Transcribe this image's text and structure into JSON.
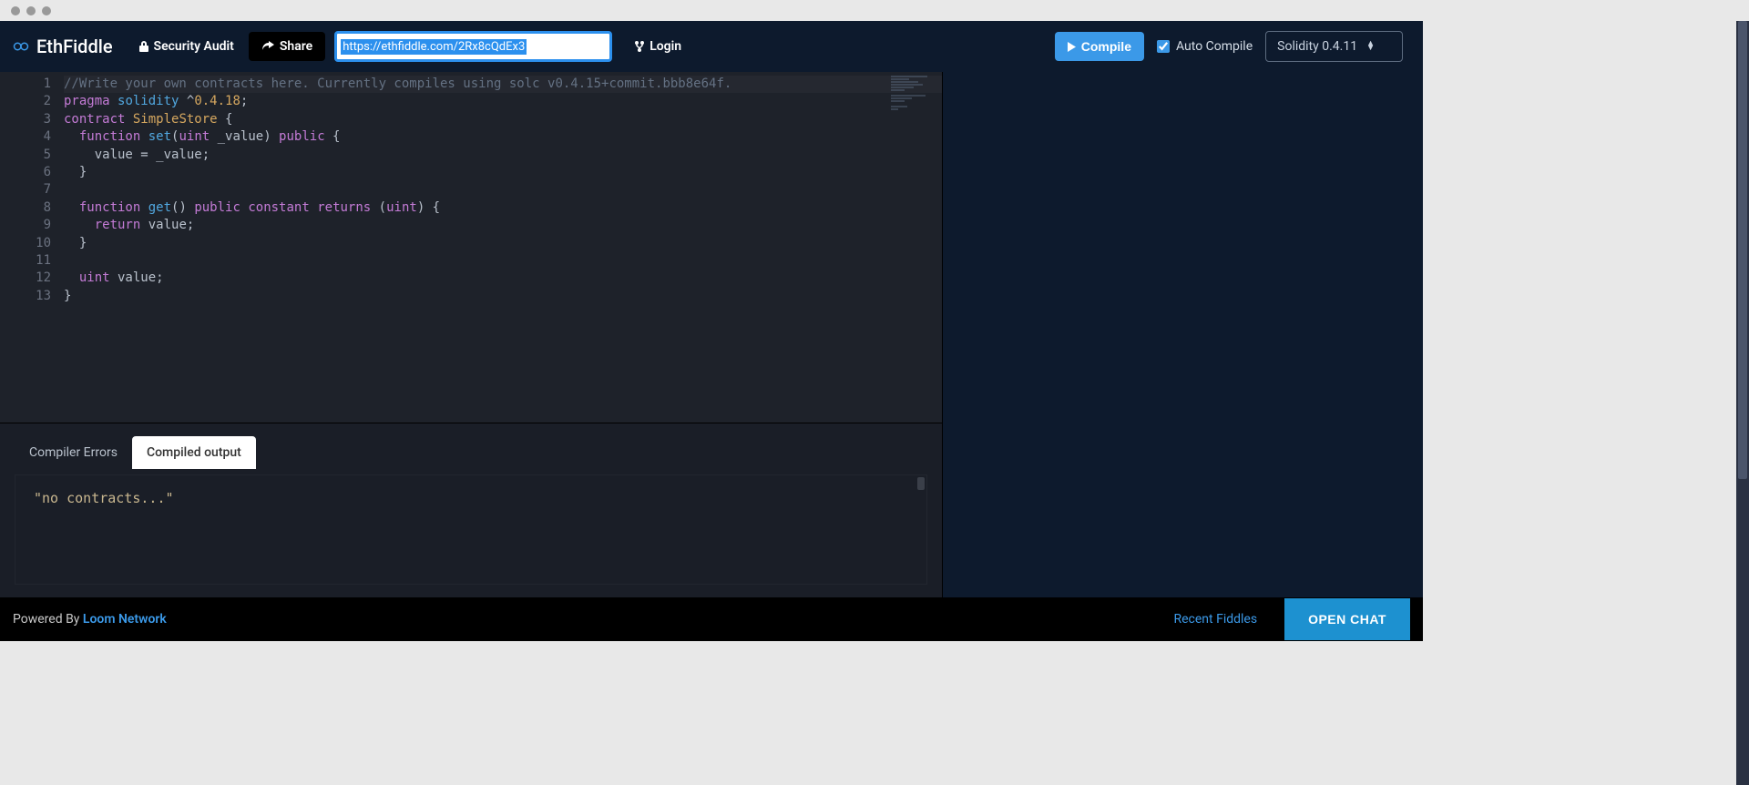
{
  "app_name": "EthFiddle",
  "nav": {
    "security_audit": "Security Audit",
    "share": "Share",
    "login": "Login"
  },
  "share_url": "https://ethfiddle.com/2Rx8cQdEx3",
  "compile": {
    "button": "Compile",
    "auto_label": "Auto Compile",
    "auto_checked": true,
    "version": "Solidity 0.4.11"
  },
  "editor": {
    "lines": [
      {
        "n": 1,
        "tokens": [
          {
            "t": "//Write your own contracts here. Currently compiles using solc v0.4.15+commit.bbb8e64f.",
            "c": "c-comment"
          }
        ]
      },
      {
        "n": 2,
        "tokens": [
          {
            "t": "pragma",
            "c": "c-keyword"
          },
          {
            "t": " ",
            "c": ""
          },
          {
            "t": "solidity",
            "c": "c-builtin"
          },
          {
            "t": " ^",
            "c": "c-punc"
          },
          {
            "t": "0.4.18",
            "c": "c-num"
          },
          {
            "t": ";",
            "c": "c-punc"
          }
        ]
      },
      {
        "n": 3,
        "tokens": [
          {
            "t": "contract",
            "c": "c-keyword"
          },
          {
            "t": " ",
            "c": ""
          },
          {
            "t": "SimpleStore",
            "c": "c-ident"
          },
          {
            "t": " {",
            "c": "c-punc"
          }
        ]
      },
      {
        "n": 4,
        "tokens": [
          {
            "t": "  ",
            "c": ""
          },
          {
            "t": "function",
            "c": "c-keyword"
          },
          {
            "t": " ",
            "c": ""
          },
          {
            "t": "set",
            "c": "c-fn"
          },
          {
            "t": "(",
            "c": "c-punc"
          },
          {
            "t": "uint",
            "c": "c-type"
          },
          {
            "t": " _value) ",
            "c": "c-punc"
          },
          {
            "t": "public",
            "c": "c-keyword"
          },
          {
            "t": " {",
            "c": "c-punc"
          }
        ]
      },
      {
        "n": 5,
        "tokens": [
          {
            "t": "    value = _value;",
            "c": "c-punc"
          }
        ]
      },
      {
        "n": 6,
        "tokens": [
          {
            "t": "  }",
            "c": "c-punc"
          }
        ]
      },
      {
        "n": 7,
        "tokens": [
          {
            "t": "",
            "c": ""
          }
        ]
      },
      {
        "n": 8,
        "tokens": [
          {
            "t": "  ",
            "c": ""
          },
          {
            "t": "function",
            "c": "c-keyword"
          },
          {
            "t": " ",
            "c": ""
          },
          {
            "t": "get",
            "c": "c-fn"
          },
          {
            "t": "() ",
            "c": "c-punc"
          },
          {
            "t": "public",
            "c": "c-keyword"
          },
          {
            "t": " ",
            "c": ""
          },
          {
            "t": "constant",
            "c": "c-keyword"
          },
          {
            "t": " ",
            "c": ""
          },
          {
            "t": "returns",
            "c": "c-keyword"
          },
          {
            "t": " (",
            "c": "c-punc"
          },
          {
            "t": "uint",
            "c": "c-type"
          },
          {
            "t": ") {",
            "c": "c-punc"
          }
        ]
      },
      {
        "n": 9,
        "tokens": [
          {
            "t": "    ",
            "c": ""
          },
          {
            "t": "return",
            "c": "c-keyword"
          },
          {
            "t": " value;",
            "c": "c-punc"
          }
        ]
      },
      {
        "n": 10,
        "tokens": [
          {
            "t": "  }",
            "c": "c-punc"
          }
        ]
      },
      {
        "n": 11,
        "tokens": [
          {
            "t": "",
            "c": ""
          }
        ]
      },
      {
        "n": 12,
        "tokens": [
          {
            "t": "  ",
            "c": ""
          },
          {
            "t": "uint",
            "c": "c-type"
          },
          {
            "t": " value;",
            "c": "c-punc"
          }
        ]
      },
      {
        "n": 13,
        "tokens": [
          {
            "t": "}",
            "c": "c-punc"
          }
        ]
      }
    ]
  },
  "tabs": {
    "errors": "Compiler Errors",
    "output": "Compiled output"
  },
  "output_text": "\"no contracts...\"",
  "footer": {
    "powered_prefix": "Powered By ",
    "powered_link": "Loom Network",
    "recent": "Recent Fiddles",
    "chat": "OPEN CHAT"
  }
}
